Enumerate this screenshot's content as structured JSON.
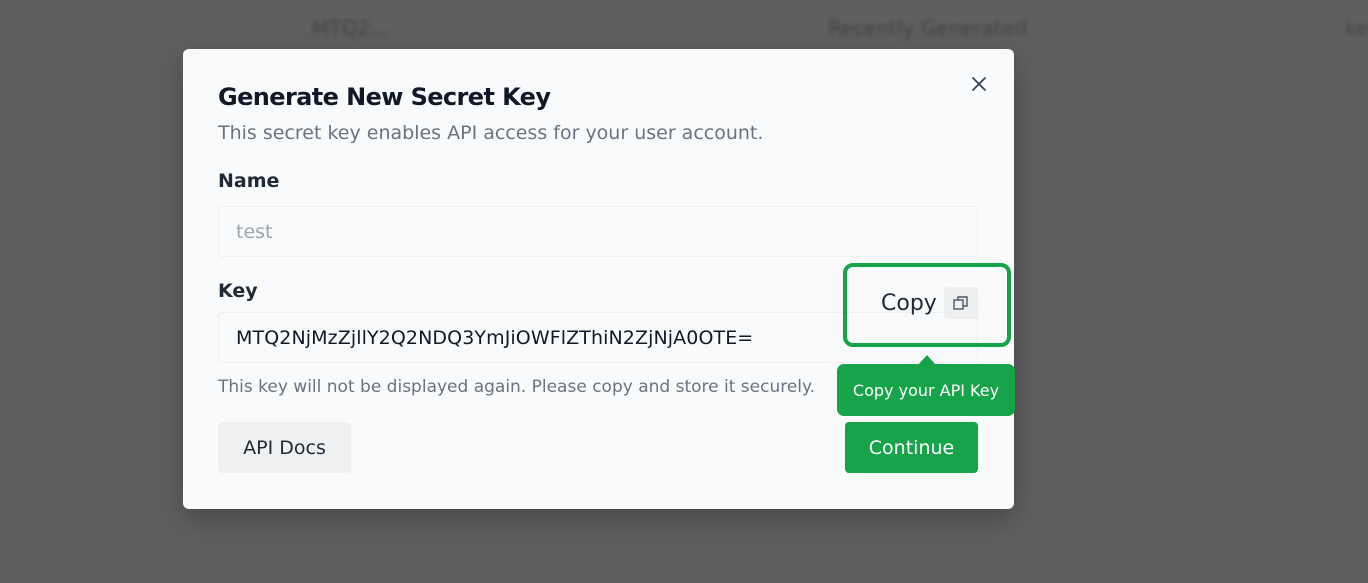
{
  "background": {
    "texts": [
      "MTQ2...",
      "Recently Generated",
      "ke"
    ]
  },
  "dialog": {
    "title": "Generate New Secret Key",
    "description": "This secret key enables API access for your user account.",
    "name_label": "Name",
    "name_value": "test",
    "key_label": "Key",
    "key_value": "MTQ2NjMzZjllY2Q2NDQ3YmJiOWFlZThiN2ZjNjA0OTE=",
    "copy_label": "Copy",
    "hint": "This key will not be displayed again. Please copy and store it securely.",
    "docs_label": "API Docs",
    "continue_label": "Continue",
    "close_icon": "close-icon",
    "copy_icon": "copy-icon"
  },
  "tooltip": {
    "text": "Copy your API Key"
  },
  "colors": {
    "overlay": "#5f5f5f",
    "accent": "#16a34a",
    "dialog_bg": "#f9fafb"
  }
}
